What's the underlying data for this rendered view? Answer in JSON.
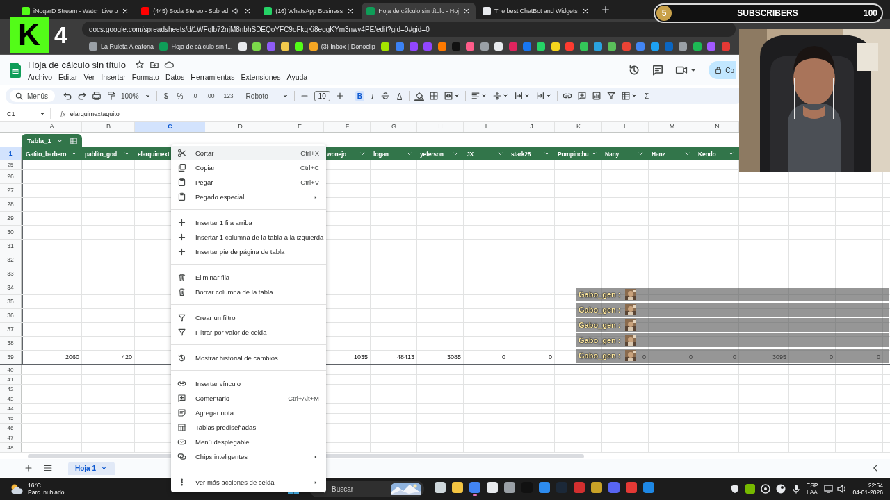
{
  "browser": {
    "tabs": [
      {
        "title": "iNoqarD Stream - Watch Live o",
        "selected": false,
        "audio": false,
        "color": "#53fc18"
      },
      {
        "title": "(445) Soda Stereo - Sobred",
        "selected": false,
        "audio": true,
        "color": "#ff0000"
      },
      {
        "title": "(16) WhatsApp Business",
        "selected": false,
        "audio": false,
        "color": "#25d366"
      },
      {
        "title": "Hoja de cálculo sin título - Hoj",
        "selected": true,
        "audio": false,
        "color": "#0f9d58"
      },
      {
        "title": "The best ChatBot and Widgets",
        "selected": false,
        "audio": false,
        "color": "#e8eaed"
      }
    ],
    "url": "docs.google.com/spreadsheets/d/1WFqlb72njM8nbhSDEQoYFC9oFkqKi8eggKYm3nwy4PE/edit?gid=0#gid=0",
    "bookmarks": [
      {
        "label": "La Ruleta Aleatoria",
        "color": "#9aa0a6"
      },
      {
        "label": "Hoja de cálculo sin t...",
        "color": "#0f9d58"
      },
      {
        "color": "#e8eaed"
      },
      {
        "color": "#7bd94a"
      },
      {
        "color": "#8e5cf7"
      },
      {
        "color": "#f2c94c"
      },
      {
        "color": "#53fc18"
      },
      {
        "label": "(3) Inbox | Donoclip",
        "color": "#f5a623"
      },
      {
        "color": "#a4e400"
      },
      {
        "color": "#3b82f6"
      },
      {
        "color": "#9146ff"
      },
      {
        "color": "#9146ff"
      },
      {
        "color": "#ff7a00"
      },
      {
        "color": "#111111"
      },
      {
        "color": "#ff5c8a"
      },
      {
        "color": "#9aa0a6"
      },
      {
        "color": "#e8eaed"
      },
      {
        "color": "#e0245e"
      },
      {
        "color": "#1877f2"
      },
      {
        "color": "#25d366"
      },
      {
        "color": "#f7d51d"
      },
      {
        "color": "#ff3b30"
      },
      {
        "color": "#34c759"
      },
      {
        "color": "#2aa3e0"
      },
      {
        "color": "#5ac05a"
      },
      {
        "color": "#ea4335"
      },
      {
        "color": "#4285f4"
      },
      {
        "color": "#1da1f2"
      },
      {
        "color": "#0a66c2"
      },
      {
        "color": "#9aa0a6"
      },
      {
        "color": "#1db954"
      },
      {
        "color": "#a259ff"
      },
      {
        "color": "#e53935"
      }
    ]
  },
  "stream_overlay": {
    "logo": {
      "letter": "K",
      "number": "4"
    },
    "subscribers": {
      "count": "5",
      "label": "SUBSCRIBERS",
      "goal": "100"
    }
  },
  "document": {
    "title": "Hoja de cálculo sin título",
    "menu": [
      "Archivo",
      "Editar",
      "Ver",
      "Insertar",
      "Formato",
      "Datos",
      "Herramientas",
      "Extensiones",
      "Ayuda"
    ],
    "share_label": "Co"
  },
  "toolbar": {
    "search": "Menús",
    "zoom": "100%",
    "currency": "$",
    "percent": "%",
    "decrease_decimals": ".0",
    "increase_decimals": ".00",
    "number_format": "123",
    "font": "Roboto",
    "font_size": "10",
    "bold": {
      "label": "B",
      "on": true
    },
    "italic": "I",
    "text_color": "A",
    "sum": "Σ"
  },
  "formula_bar": {
    "cell": "C1",
    "fx": "fx",
    "value": "elarquimextaquito"
  },
  "grid": {
    "columns": [
      {
        "letter": "A",
        "selected": false
      },
      {
        "letter": "B",
        "selected": false
      },
      {
        "letter": "C",
        "selected": true
      },
      {
        "letter": "D",
        "selected": false
      },
      {
        "letter": "E",
        "selected": false
      },
      {
        "letter": "F",
        "selected": false
      },
      {
        "letter": "G",
        "selected": false
      },
      {
        "letter": "H",
        "selected": false
      },
      {
        "letter": "I",
        "selected": false
      },
      {
        "letter": "J",
        "selected": false
      },
      {
        "letter": "K",
        "selected": false
      },
      {
        "letter": "L",
        "selected": false
      },
      {
        "letter": "M",
        "selected": false
      },
      {
        "letter": "N",
        "selected": false
      }
    ],
    "table_name": "Tabla_1",
    "header_row": {
      "number": "1",
      "selected": true,
      "cells": [
        {
          "label": "Gatito_barbero",
          "chevron": true
        },
        {
          "label": "pablito_god",
          "chevron": true
        },
        {
          "label": "elarquimext",
          "chevron": false
        },
        null,
        null,
        {
          "label": "wonejo",
          "chevron": true
        },
        {
          "label": "logan",
          "chevron": true
        },
        {
          "label": "yeferson",
          "chevron": true
        },
        {
          "label": "JX",
          "chevron": true
        },
        {
          "label": "stark28",
          "chevron": true
        },
        {
          "label": "Pompinchu",
          "chevron": true
        },
        {
          "label": "Nany",
          "chevron": true
        },
        {
          "label": "Hanz",
          "chevron": true
        },
        {
          "label": "Kendo",
          "chevron": true
        }
      ]
    },
    "rows": [
      {
        "number": "25",
        "selected": false
      },
      {
        "number": "26",
        "selected": false
      },
      {
        "number": "27",
        "selected": false
      },
      {
        "number": "28",
        "selected": false
      },
      {
        "number": "29",
        "selected": false
      },
      {
        "number": "30",
        "selected": false
      },
      {
        "number": "31",
        "selected": false
      },
      {
        "number": "32",
        "selected": false
      },
      {
        "number": "33",
        "selected": false
      },
      {
        "number": "34",
        "selected": false
      },
      {
        "number": "35",
        "selected": false
      },
      {
        "number": "36",
        "selected": false
      },
      {
        "number": "37",
        "selected": false
      },
      {
        "number": "38",
        "selected": false
      },
      {
        "number": "39",
        "selected": false,
        "cells": [
          "2060",
          "420",
          null,
          null,
          null,
          "1035",
          "48413",
          "3085",
          "0",
          "0",
          null,
          "0",
          "0",
          "0",
          "3095",
          "0",
          "0"
        ]
      },
      {
        "number": "40",
        "selected": false
      },
      {
        "number": "41",
        "selected": false
      },
      {
        "number": "42",
        "selected": false
      },
      {
        "number": "43",
        "selected": false
      },
      {
        "number": "44",
        "selected": false
      },
      {
        "number": "45",
        "selected": false
      },
      {
        "number": "46",
        "selected": false
      },
      {
        "number": "47",
        "selected": false
      },
      {
        "number": "48",
        "selected": false
      }
    ]
  },
  "context_menu": {
    "groups": [
      [
        {
          "kind": "scissors",
          "label": "Cortar",
          "shortcut": "Ctrl+X",
          "submenu": false,
          "highlighted": true
        },
        {
          "kind": "copy",
          "label": "Copiar",
          "shortcut": "Ctrl+C",
          "submenu": false,
          "highlighted": false
        },
        {
          "kind": "paste",
          "label": "Pegar",
          "shortcut": "Ctrl+V",
          "submenu": false,
          "highlighted": false
        },
        {
          "kind": "paste",
          "label": "Pegado especial",
          "submenu": true,
          "highlighted": false
        }
      ],
      [
        {
          "kind": "plus",
          "label": "Insertar 1 fila arriba",
          "submenu": false,
          "highlighted": false
        },
        {
          "kind": "plus",
          "label": "Insertar 1 columna de la tabla a la izquierda",
          "submenu": false,
          "highlighted": false
        },
        {
          "kind": "plus",
          "label": "Insertar pie de página de tabla",
          "submenu": false,
          "highlighted": false
        }
      ],
      [
        {
          "kind": "trash",
          "label": "Eliminar fila",
          "submenu": false,
          "highlighted": false
        },
        {
          "kind": "trash",
          "label": "Borrar columna de la tabla",
          "submenu": false,
          "highlighted": false
        }
      ],
      [
        {
          "kind": "filter",
          "label": "Crear un filtro",
          "submenu": false,
          "highlighted": false
        },
        {
          "kind": "filter",
          "label": "Filtrar por valor de celda",
          "submenu": false,
          "highlighted": false
        }
      ],
      [
        {
          "kind": "history",
          "label": "Mostrar historial de cambios",
          "submenu": false,
          "highlighted": false
        }
      ],
      [
        {
          "kind": "link",
          "label": "Insertar vínculo",
          "submenu": false,
          "highlighted": false
        },
        {
          "kind": "comment",
          "label": "Comentario",
          "shortcut": "Ctrl+Alt+M",
          "submenu": false,
          "highlighted": false
        },
        {
          "kind": "note",
          "label": "Agregar nota",
          "submenu": false,
          "highlighted": false
        },
        {
          "kind": "table",
          "label": "Tablas prediseñadas",
          "submenu": false,
          "highlighted": false
        },
        {
          "kind": "dropdown",
          "label": "Menú desplegable",
          "submenu": false,
          "highlighted": false
        },
        {
          "kind": "chips",
          "label": "Chips inteligentes",
          "submenu": true,
          "highlighted": false
        }
      ],
      [
        {
          "kind": "more",
          "label": "Ver más acciones de celda",
          "submenu": true,
          "highlighted": false
        }
      ]
    ]
  },
  "chat_overlay": [
    {
      "user": "Gabo_gen :",
      "kind": "picture"
    },
    {
      "user": "Gabo_gen :",
      "kind": "picture"
    },
    {
      "user": "Gabo_gen :",
      "kind": "picture"
    },
    {
      "user": "Gabo_gen :",
      "kind": "picture"
    },
    {
      "user": "Gabo_gen :",
      "kind": "picture"
    }
  ],
  "sheet_tabs": [
    {
      "label": "Hoja 1",
      "selected": true
    }
  ],
  "taskbar": {
    "temperature": "16°C",
    "weather": "Parc. nublado",
    "search": "Buscar",
    "apps": [
      {
        "color": "#cfd8dc",
        "active": false
      },
      {
        "color": "#f4c542",
        "active": false
      },
      {
        "color": "#4285f4",
        "active": true
      },
      {
        "color": "#e8eaed",
        "active": false
      },
      {
        "color": "#9aa0a6",
        "active": false
      },
      {
        "color": "#111111",
        "active": false
      },
      {
        "color": "#2d8cf0",
        "active": false
      },
      {
        "color": "#1b2838",
        "active": false
      },
      {
        "color": "#d32f2f",
        "active": false
      },
      {
        "color": "#c9a227",
        "active": false
      },
      {
        "color": "#5865f2",
        "active": false
      },
      {
        "color": "#e53935",
        "active": false
      },
      {
        "color": "#1e88e5",
        "active": false
      }
    ],
    "language": "ESP",
    "layout": "LAA",
    "time": "22:54",
    "date": "04-01-2026"
  }
}
